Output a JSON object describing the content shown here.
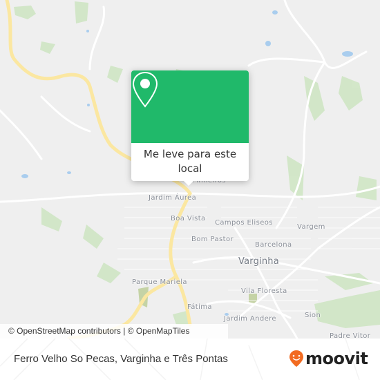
{
  "map": {
    "popup": {
      "icon": "location-pin-icon",
      "action_label": "Me leve para este local",
      "accent_color": "#20b96a"
    },
    "labels": [
      {
        "name": "pinheiros",
        "text": "Pinheiros"
      },
      {
        "name": "jardim-aurea",
        "text": "Jardim Áurea"
      },
      {
        "name": "boa-vista",
        "text": "Boa Vista"
      },
      {
        "name": "campos-eliseos",
        "text": "Campos Eliseos"
      },
      {
        "name": "vargem",
        "text": "Vargem"
      },
      {
        "name": "bom-pastor",
        "text": "Bom Pastor"
      },
      {
        "name": "barcelona",
        "text": "Barcelona"
      },
      {
        "name": "varginha",
        "text": "Varginha"
      },
      {
        "name": "parque-mariela",
        "text": "Parque Mariela"
      },
      {
        "name": "vila-floresta",
        "text": "Vila Floresta"
      },
      {
        "name": "fatima",
        "text": "Fátima"
      },
      {
        "name": "jardim-andere",
        "text": "Jardim Andere"
      },
      {
        "name": "sion",
        "text": "Sion"
      },
      {
        "name": "padre-vitor",
        "text": "Padre Vitor"
      }
    ],
    "attribution": "© OpenStreetMap contributors | © OpenMapTiles"
  },
  "footer": {
    "title": "Ferro Velho So Pecas, Varginha e Três Pontas",
    "logo_text": "moovit",
    "logo_icon": "moovit-pin-icon",
    "logo_color": "#f26b21"
  }
}
